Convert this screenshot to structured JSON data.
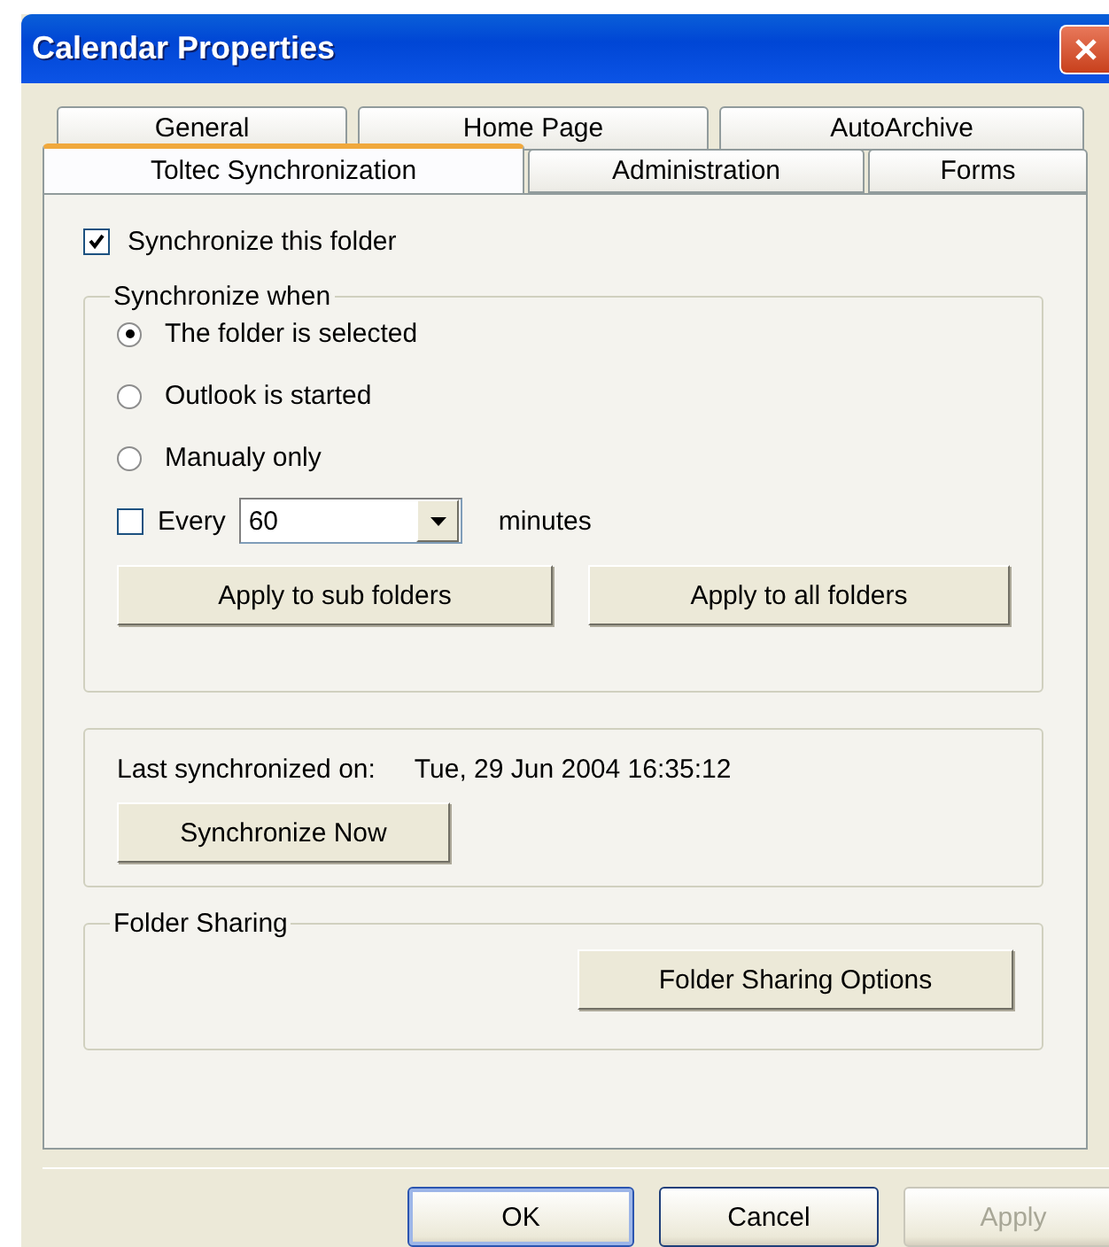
{
  "window": {
    "title": "Calendar Properties"
  },
  "tab_rows": [
    [
      {
        "label": "General",
        "selected": false
      },
      {
        "label": "Home Page",
        "selected": false
      },
      {
        "label": "AutoArchive",
        "selected": false
      }
    ],
    [
      {
        "label": "Toltec Synchronization",
        "selected": true
      },
      {
        "label": "Administration",
        "selected": false
      },
      {
        "label": "Forms",
        "selected": false
      }
    ]
  ],
  "sync_folder": {
    "label": "Synchronize this folder",
    "checked": true
  },
  "sync_when": {
    "title": "Synchronize when",
    "options": [
      {
        "label": "The folder is selected",
        "selected": true
      },
      {
        "label": "Outlook is started",
        "selected": false
      },
      {
        "label": "Manualy only",
        "selected": false
      }
    ],
    "every": {
      "label": "Every",
      "checked": false,
      "value": "60",
      "unit": "minutes"
    },
    "buttons": [
      "Apply to sub folders",
      "Apply to all folders"
    ]
  },
  "last_sync": {
    "label": "Last synchronized on:",
    "value": "Tue, 29 Jun 2004 16:35:12",
    "button": "Synchronize Now"
  },
  "folder_sharing": {
    "title": "Folder Sharing",
    "button": "Folder Sharing Options"
  },
  "buttons": [
    {
      "label": "OK",
      "default": true,
      "disabled": false
    },
    {
      "label": "Cancel",
      "default": false,
      "disabled": false
    },
    {
      "label": "Apply",
      "default": false,
      "disabled": true
    }
  ]
}
